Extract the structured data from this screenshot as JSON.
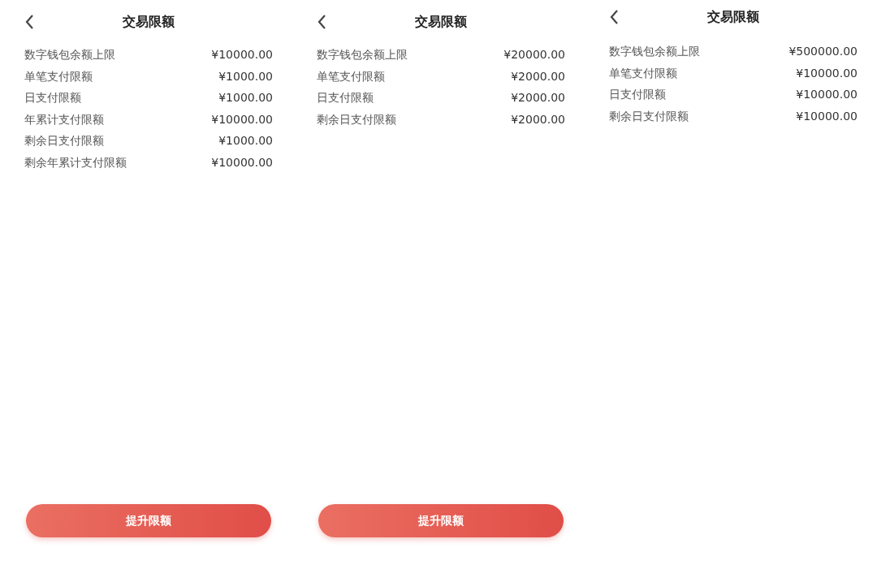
{
  "screens": [
    {
      "title": "交易限额",
      "rows": [
        {
          "label": "数字钱包余额上限",
          "value": "¥10000.00"
        },
        {
          "label": "单笔支付限额",
          "value": "¥1000.00"
        },
        {
          "label": "日支付限额",
          "value": "¥1000.00"
        },
        {
          "label": "年累计支付限额",
          "value": "¥10000.00"
        },
        {
          "label": "剩余日支付限额",
          "value": "¥1000.00"
        },
        {
          "label": "剩余年累计支付限额",
          "value": "¥10000.00"
        }
      ],
      "button": "提升限额"
    },
    {
      "title": "交易限额",
      "rows": [
        {
          "label": "数字钱包余额上限",
          "value": "¥20000.00"
        },
        {
          "label": "单笔支付限额",
          "value": "¥2000.00"
        },
        {
          "label": "日支付限额",
          "value": "¥2000.00"
        },
        {
          "label": "剩余日支付限额",
          "value": "¥2000.00"
        }
      ],
      "button": "提升限额"
    },
    {
      "title": "交易限额",
      "rows": [
        {
          "label": "数字钱包余额上限",
          "value": "¥500000.00"
        },
        {
          "label": "单笔支付限额",
          "value": "¥10000.00"
        },
        {
          "label": "日支付限额",
          "value": "¥10000.00"
        },
        {
          "label": "剩余日支付限额",
          "value": "¥10000.00"
        }
      ]
    }
  ]
}
